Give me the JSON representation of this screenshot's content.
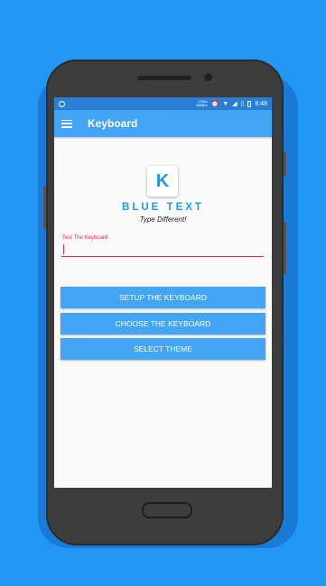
{
  "statusbar": {
    "net_up": "378/s",
    "net_down": "288B/s",
    "time": "8:48"
  },
  "appbar": {
    "title": "Keyboard"
  },
  "brand": {
    "logo_letter": "K",
    "name": "BLUE TEXT",
    "tagline": "Type Different!"
  },
  "test_field": {
    "label": "Test The Keyboard",
    "value": "",
    "placeholder": ""
  },
  "buttons": {
    "setup": "SETUP THE KEYBOARD",
    "choose": "CHOOSE THE KEYBOARD",
    "theme": "SELECT THEME"
  },
  "colors": {
    "background": "#2196F3",
    "accent": "#42A5F5",
    "brand_text": "#1e9be8",
    "field_accent": "#e91e63"
  }
}
